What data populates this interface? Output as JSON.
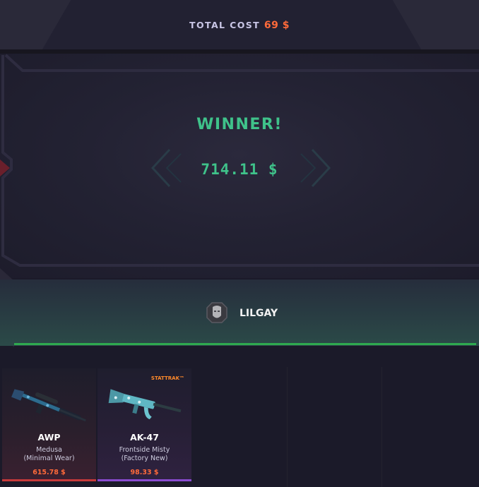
{
  "header": {
    "total_label": "TOTAL COST",
    "total_value": "69 $"
  },
  "winner": {
    "title": "WINNER!",
    "amount": "714.11 $",
    "player_name": "LILGAY"
  },
  "items": [
    {
      "weapon": "AWP",
      "skin_line1": "Medusa",
      "skin_line2": "(Minimal Wear)",
      "price": "615.78 $",
      "rarity_color": "#c73a3a",
      "stattrak": ""
    },
    {
      "weapon": "AK-47",
      "skin_line1": "Frontside Misty",
      "skin_line2": "(Factory New)",
      "price": "98.33 $",
      "rarity_color": "#8a4bd1",
      "stattrak": "STATTRAK™"
    }
  ],
  "colors": {
    "accent_green": "#3fc28a",
    "cost_orange": "#ff6a3a",
    "band_line": "#2fa94f"
  }
}
